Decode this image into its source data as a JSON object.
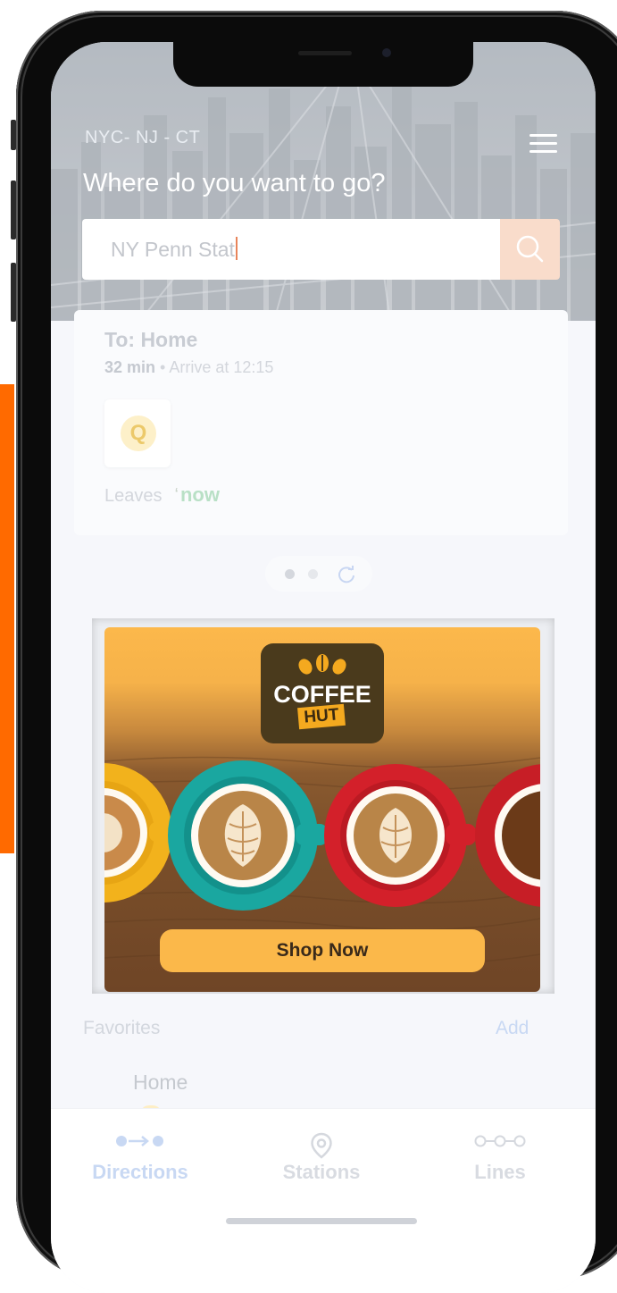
{
  "colors": {
    "accent_orange": "#ff6a00",
    "search_button": "#f9dccb",
    "ad_yellow": "#fbb84a",
    "tab_active": "#c8d8f3"
  },
  "header": {
    "region": "NYC- NJ - CT",
    "headline": "Where do you want to go?",
    "search_value": "NY Penn Stat",
    "menu_icon": "hamburger-menu-icon",
    "search_icon": "magnifier-icon"
  },
  "trip": {
    "to": "To: Home",
    "duration": "32 min",
    "arrive": "• Arrive at 12:15",
    "line": "Q",
    "leaves_label": "Leaves",
    "leaves_value": "now"
  },
  "ad": {
    "brand_line1": "COFFEE",
    "brand_line2": "HUT",
    "cta": "Shop Now"
  },
  "favorites": {
    "title": "Favorites",
    "add": "Add",
    "item": "Home"
  },
  "tabs": [
    {
      "label": "Directions",
      "icon": "directions-icon"
    },
    {
      "label": "Stations",
      "icon": "location-pin-icon"
    },
    {
      "label": "Lines",
      "icon": "lines-icon"
    }
  ]
}
